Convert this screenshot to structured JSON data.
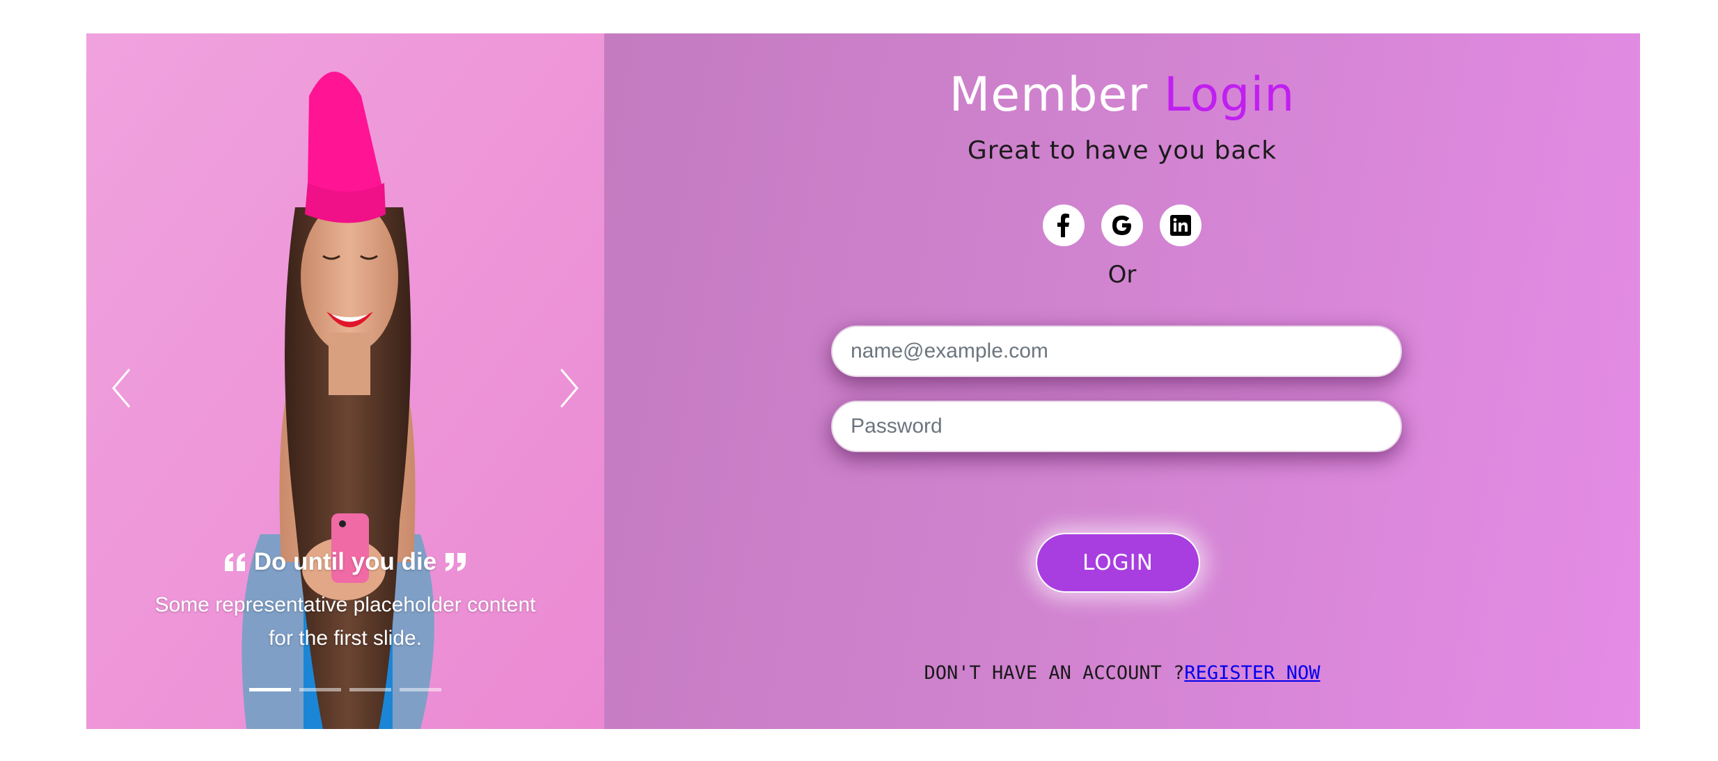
{
  "carousel": {
    "prev_icon": "chevron-left-icon",
    "next_icon": "chevron-right-icon",
    "slide": {
      "quote": "Do until you die",
      "text": "Some representative placeholder content for the first slide."
    },
    "indicators": {
      "count": 4,
      "active": 0
    }
  },
  "login": {
    "title_part1": "Member",
    "title_part2": "Login",
    "subtitle": "Great to have you back",
    "social_icons": [
      "facebook-icon",
      "google-icon",
      "linkedin-icon"
    ],
    "or_text": "Or",
    "email": {
      "placeholder": "name@example.com",
      "value": ""
    },
    "password": {
      "placeholder": "Password",
      "value": ""
    },
    "login_button_label": "LOGIN",
    "register_prompt": "DON'T HAVE AN ACCOUNT ?",
    "register_link": "REGISTER NOW"
  },
  "colors": {
    "accent": "#c01ff0",
    "button": "#a83ee0",
    "panel_start": "#c47bc0",
    "panel_end": "#e58ce6",
    "carousel_bg": "#ee96d8"
  }
}
